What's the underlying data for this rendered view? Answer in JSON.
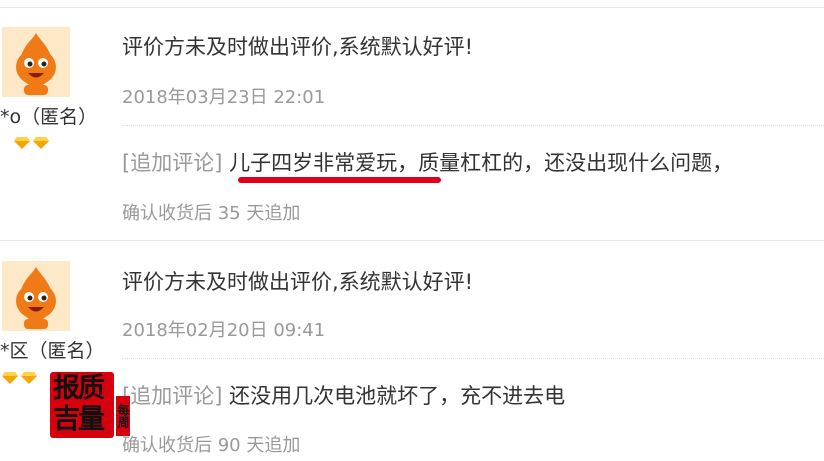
{
  "reviews": [
    {
      "user": "*o（匿名）",
      "content": "评价方未及时做出评价,系统默认好评!",
      "date": "2018年03月23日 22:01",
      "append_tag": "[追加评论]",
      "append_text": "儿子四岁非常爱玩，质量杠杠的，还没出现什么问题，",
      "append_after": "确认收货后 35 天追加"
    },
    {
      "user": "*区（匿名）",
      "content": "评价方未及时做出评价,系统默认好评!",
      "date": "2018年02月20日 09:41",
      "append_tag": "[追加评论]",
      "append_text": "还没用几次电池就坏了，充不进去电",
      "append_after": "确认收货后 90 天追加"
    }
  ],
  "stamp": {
    "line1": "报质",
    "line2": "吉量",
    "side": "每周"
  },
  "colors": {
    "avatar": "#f07a16",
    "diamond": "#f7a600",
    "underline": "#e0001b",
    "stamp": "#d7000f"
  }
}
